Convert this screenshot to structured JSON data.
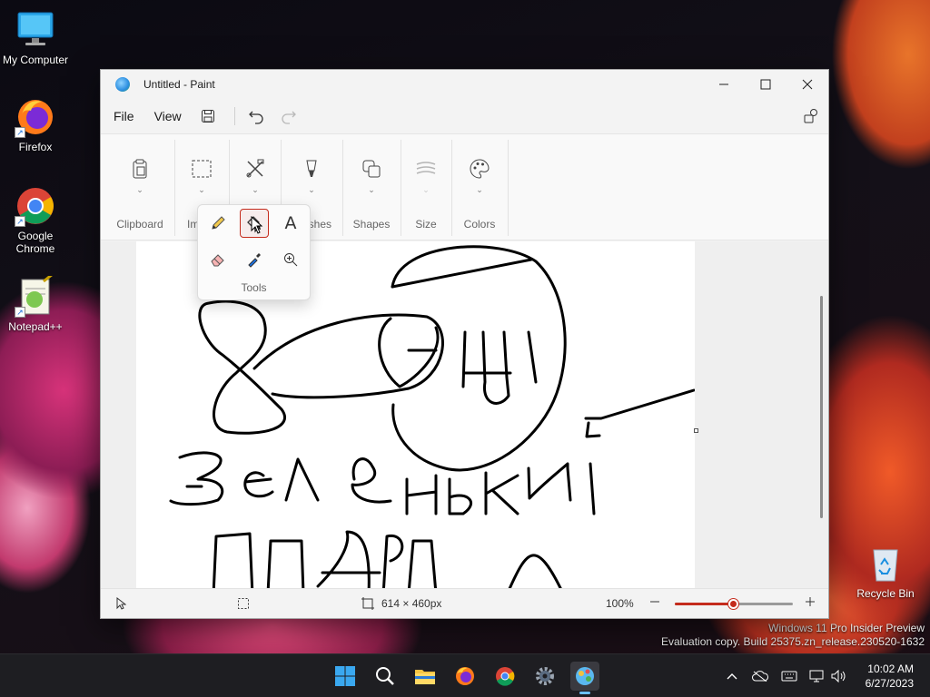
{
  "desktop": {
    "icons": [
      {
        "label": "My Computer"
      },
      {
        "label": "Firefox"
      },
      {
        "label": "Google Chrome"
      },
      {
        "label": "Notepad++"
      },
      {
        "label": "Recycle Bin"
      }
    ],
    "watermark_line1": "Windows 11 Pro Insider Preview",
    "watermark_line2": "Evaluation copy. Build 25375.zn_release.230520-1632"
  },
  "paint": {
    "title": "Untitled - Paint",
    "menu": {
      "file": "File",
      "view": "View"
    },
    "ribbon_groups": {
      "clipboard": "Clipboard",
      "image": "Im",
      "brushes": "shes",
      "shapes": "Shapes",
      "size": "Size",
      "colors": "Colors"
    },
    "tools_flyout": {
      "label": "Tools",
      "active": "fill-tool"
    },
    "status": {
      "canvas_size": "614 × 460px",
      "zoom": "100%",
      "zoom_percent": 100
    }
  },
  "taskbar": {
    "time": "10:02 AM",
    "date": "6/27/2023"
  },
  "colors": {
    "accent": "#c42b1c",
    "taskbar": "#1e1e22"
  }
}
